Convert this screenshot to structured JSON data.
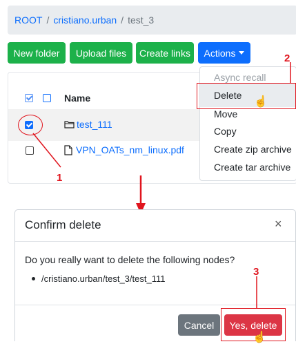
{
  "breadcrumb": {
    "root": "ROOT",
    "sep1": "/",
    "user": "cristiano.urban",
    "sep2": "/",
    "current": "test_3"
  },
  "toolbar": {
    "new_folder": "New folder",
    "upload_files": "Upload files",
    "create_links": "Create links",
    "actions": "Actions"
  },
  "table": {
    "header_name": "Name",
    "rows": [
      {
        "name": "test_111",
        "type": "folder",
        "checked": true
      },
      {
        "name": "VPN_OATs_nm_linux.pdf",
        "type": "file",
        "checked": false
      }
    ]
  },
  "actions_menu": {
    "items": [
      "Async recall",
      "Delete",
      "Move",
      "Copy",
      "Create zip archive",
      "Create tar archive"
    ]
  },
  "annotations": {
    "step1": "1",
    "step2": "2",
    "step3": "3",
    "color": "#e0151e"
  },
  "modal": {
    "title": "Confirm delete",
    "close": "×",
    "question": "Do you really want to delete the following nodes?",
    "nodes": [
      "/cristiano.urban/test_3/test_111"
    ],
    "cancel": "Cancel",
    "confirm": "Yes, delete"
  },
  "colors": {
    "primary": "#0d6efd",
    "success": "#1cb14a",
    "danger": "#dc3545",
    "secondary": "#6c757d"
  }
}
